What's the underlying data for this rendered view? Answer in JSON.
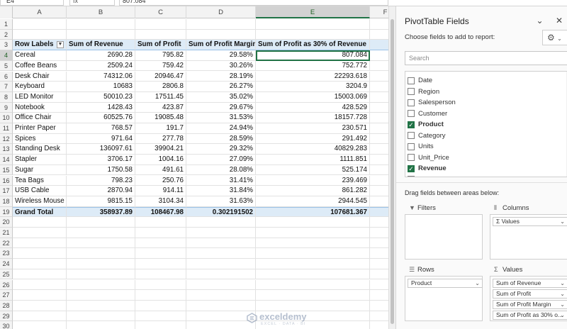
{
  "formula_bar": {
    "name_box": "E4",
    "fx": "fx",
    "value": "807.084"
  },
  "columns": [
    "A",
    "B",
    "C",
    "D",
    "E",
    "F"
  ],
  "selected_column": "E",
  "rows": [
    {
      "n": "1",
      "cells": [
        "",
        "",
        "",
        "",
        ""
      ]
    },
    {
      "n": "2",
      "cells": [
        "",
        "",
        "",
        "",
        ""
      ]
    },
    {
      "n": "3",
      "type": "header",
      "cells": [
        "Row Labels",
        "Sum of Revenue",
        "Sum of Profit",
        "Sum of Profit Margin",
        "Sum of  Profit as 30% of Revenue"
      ]
    },
    {
      "n": "4",
      "cells": [
        "Cereal",
        "2690.28",
        "795.82",
        "29.58%",
        "807.084"
      ]
    },
    {
      "n": "5",
      "cells": [
        "Coffee Beans",
        "2509.24",
        "759.42",
        "30.26%",
        "752.772"
      ]
    },
    {
      "n": "6",
      "cells": [
        "Desk Chair",
        "74312.06",
        "20946.47",
        "28.19%",
        "22293.618"
      ]
    },
    {
      "n": "7",
      "cells": [
        "Keyboard",
        "10683",
        "2806.8",
        "26.27%",
        "3204.9"
      ]
    },
    {
      "n": "8",
      "cells": [
        "LED Monitor",
        "50010.23",
        "17511.45",
        "35.02%",
        "15003.069"
      ]
    },
    {
      "n": "9",
      "cells": [
        "Notebook",
        "1428.43",
        "423.87",
        "29.67%",
        "428.529"
      ]
    },
    {
      "n": "10",
      "cells": [
        "Office Chair",
        "60525.76",
        "19085.48",
        "31.53%",
        "18157.728"
      ]
    },
    {
      "n": "11",
      "cells": [
        "Printer Paper",
        "768.57",
        "191.7",
        "24.94%",
        "230.571"
      ]
    },
    {
      "n": "12",
      "cells": [
        "Spices",
        "971.64",
        "277.78",
        "28.59%",
        "291.492"
      ]
    },
    {
      "n": "13",
      "cells": [
        "Standing Desk",
        "136097.61",
        "39904.21",
        "29.32%",
        "40829.283"
      ]
    },
    {
      "n": "14",
      "cells": [
        "Stapler",
        "3706.17",
        "1004.16",
        "27.09%",
        "1111.851"
      ]
    },
    {
      "n": "15",
      "cells": [
        "Sugar",
        "1750.58",
        "491.61",
        "28.08%",
        "525.174"
      ]
    },
    {
      "n": "16",
      "cells": [
        "Tea Bags",
        "798.23",
        "250.76",
        "31.41%",
        "239.469"
      ]
    },
    {
      "n": "17",
      "cells": [
        "USB Cable",
        "2870.94",
        "914.11",
        "31.84%",
        "861.282"
      ]
    },
    {
      "n": "18",
      "cells": [
        "Wireless Mouse",
        "9815.15",
        "3104.34",
        "31.63%",
        "2944.545"
      ]
    },
    {
      "n": "19",
      "type": "total",
      "cells": [
        "Grand Total",
        "358937.89",
        "108467.98",
        "0.302191502",
        "107681.367"
      ]
    },
    {
      "n": "20",
      "cells": [
        "",
        "",
        "",
        "",
        ""
      ]
    },
    {
      "n": "21",
      "cells": [
        "",
        "",
        "",
        "",
        ""
      ]
    },
    {
      "n": "22",
      "cells": [
        "",
        "",
        "",
        "",
        ""
      ]
    },
    {
      "n": "23",
      "cells": [
        "",
        "",
        "",
        "",
        ""
      ]
    },
    {
      "n": "24",
      "cells": [
        "",
        "",
        "",
        "",
        ""
      ]
    },
    {
      "n": "25",
      "cells": [
        "",
        "",
        "",
        "",
        ""
      ]
    },
    {
      "n": "26",
      "cells": [
        "",
        "",
        "",
        "",
        ""
      ]
    },
    {
      "n": "27",
      "cells": [
        "",
        "",
        "",
        "",
        ""
      ]
    },
    {
      "n": "28",
      "cells": [
        "",
        "",
        "",
        "",
        ""
      ]
    },
    {
      "n": "29",
      "cells": [
        "",
        "",
        "",
        "",
        ""
      ]
    },
    {
      "n": "30",
      "cells": [
        "",
        "",
        "",
        "",
        ""
      ]
    }
  ],
  "active_row": "4",
  "watermark": {
    "brand": "exceldemy",
    "tagline": "EXCEL · DATA · BI"
  },
  "pivot": {
    "title": "PivotTable Fields",
    "choose_label": "Choose fields to add to report:",
    "search_placeholder": "Search",
    "fields": [
      {
        "label": "Date",
        "checked": false
      },
      {
        "label": "Region",
        "checked": false
      },
      {
        "label": "Salesperson",
        "checked": false
      },
      {
        "label": "Customer",
        "checked": false
      },
      {
        "label": "Product",
        "checked": true
      },
      {
        "label": "Category",
        "checked": false
      },
      {
        "label": "Units",
        "checked": false
      },
      {
        "label": "Unit_Price",
        "checked": false
      },
      {
        "label": "Revenue",
        "checked": true
      },
      {
        "label": "Cost",
        "checked": false
      }
    ],
    "drag_label": "Drag fields between areas below:",
    "areas": {
      "filters": {
        "label": "Filters",
        "items": []
      },
      "columns": {
        "label": "Columns",
        "items": [
          "Σ Values"
        ]
      },
      "rows": {
        "label": "Rows",
        "items": [
          "Product"
        ]
      },
      "values": {
        "label": "Values",
        "items": [
          "Sum of Revenue",
          "Sum of Profit",
          "Sum of Profit Margin",
          "Sum of  Profit as 30% o..."
        ]
      }
    }
  },
  "colors": {
    "accent": "#217346",
    "pivot_header_fill": "#ddebf7"
  }
}
